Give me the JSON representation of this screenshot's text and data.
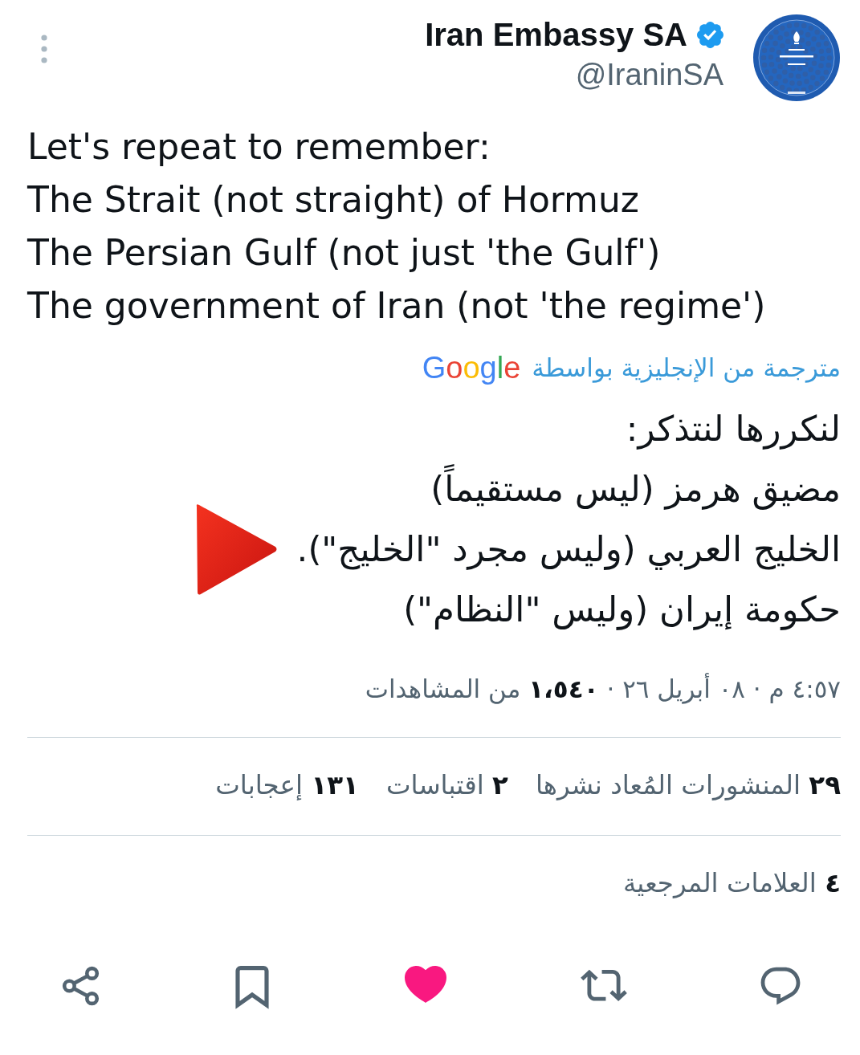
{
  "header": {
    "display_name": "Iran Embassy SA",
    "verified": true,
    "handle": "@IraninSA"
  },
  "tweet": {
    "lines": [
      "Let's repeat to remember:",
      "The Strait (not straight) of Hormuz",
      "The Persian Gulf (not just 'the Gulf')",
      "The government of Iran (not 'the regime')"
    ]
  },
  "translation": {
    "label": "مترجمة من الإنجليزية بواسطة",
    "provider": "Google",
    "lines": [
      {
        "text": "لنكررها لنتذكر:",
        "marked": false
      },
      {
        "text": "مضيق هرمز (ليس مستقيماً)",
        "marked": false
      },
      {
        "text": "الخليج العربي (وليس مجرد \"الخليج\").",
        "marked": true
      },
      {
        "text": "حكومة إيران (وليس \"النظام\")",
        "marked": false
      }
    ]
  },
  "meta": "٤:٥٧ م · ٠٨ أبريل ٢٦ · **١،٥٤٠** من المشاهدات",
  "stats": [
    {
      "count": "٢٩",
      "label": "المنشورات المُعاد نشرها"
    },
    {
      "count": "٢",
      "label": "اقتباسات"
    },
    {
      "count": "١٣١",
      "label": "إعجابات"
    }
  ],
  "bookmarks": {
    "count": "٤",
    "label": "العلامات المرجعية"
  },
  "actions": [
    {
      "kind": "reply"
    },
    {
      "kind": "repost",
      "on": false
    },
    {
      "kind": "like",
      "on": true
    },
    {
      "kind": "bookmark",
      "on": false
    },
    {
      "kind": "share"
    }
  ]
}
